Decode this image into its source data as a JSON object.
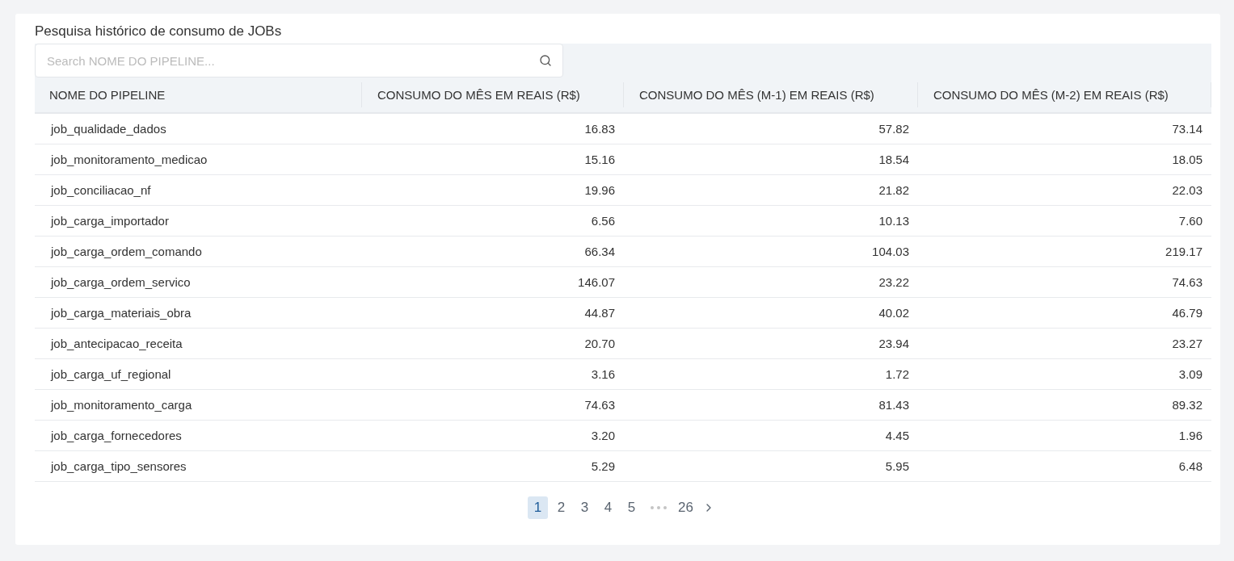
{
  "title": "Pesquisa histórico de consumo de JOBs",
  "search": {
    "placeholder": "Search NOME DO PIPELINE..."
  },
  "table": {
    "columns": [
      "NOME DO PIPELINE",
      "CONSUMO DO MÊS EM REAIS (R$)",
      "CONSUMO DO MÊS (M-1) EM REAIS (R$)",
      "CONSUMO DO MÊS (M-2) EM REAIS (R$)"
    ],
    "rows": [
      [
        "job_qualidade_dados",
        "16.83",
        "57.82",
        "73.14"
      ],
      [
        "job_monitoramento_medicao",
        "15.16",
        "18.54",
        "18.05"
      ],
      [
        "job_conciliacao_nf",
        "19.96",
        "21.82",
        "22.03"
      ],
      [
        "job_carga_importador",
        "6.56",
        "10.13",
        "7.60"
      ],
      [
        "job_carga_ordem_comando",
        "66.34",
        "104.03",
        "219.17"
      ],
      [
        "job_carga_ordem_servico",
        "146.07",
        "23.22",
        "74.63"
      ],
      [
        "job_carga_materiais_obra",
        "44.87",
        "40.02",
        "46.79"
      ],
      [
        "job_antecipacao_receita",
        "20.70",
        "23.94",
        "23.27"
      ],
      [
        "job_carga_uf_regional",
        "3.16",
        "1.72",
        "3.09"
      ],
      [
        "job_monitoramento_carga",
        "74.63",
        "81.43",
        "89.32"
      ],
      [
        "job_carga_fornecedores",
        "3.20",
        "4.45",
        "1.96"
      ],
      [
        "job_carga_tipo_sensores",
        "5.29",
        "5.95",
        "6.48"
      ]
    ]
  },
  "pagination": {
    "pages": [
      {
        "kind": "page",
        "label": "1",
        "selected": true
      },
      {
        "kind": "page",
        "label": "2",
        "selected": false
      },
      {
        "kind": "page",
        "label": "3",
        "selected": false
      },
      {
        "kind": "page",
        "label": "4",
        "selected": false
      },
      {
        "kind": "page",
        "label": "5",
        "selected": false
      },
      {
        "kind": "ellipsis"
      },
      {
        "kind": "page",
        "label": "26",
        "selected": false
      },
      {
        "kind": "next"
      }
    ]
  }
}
